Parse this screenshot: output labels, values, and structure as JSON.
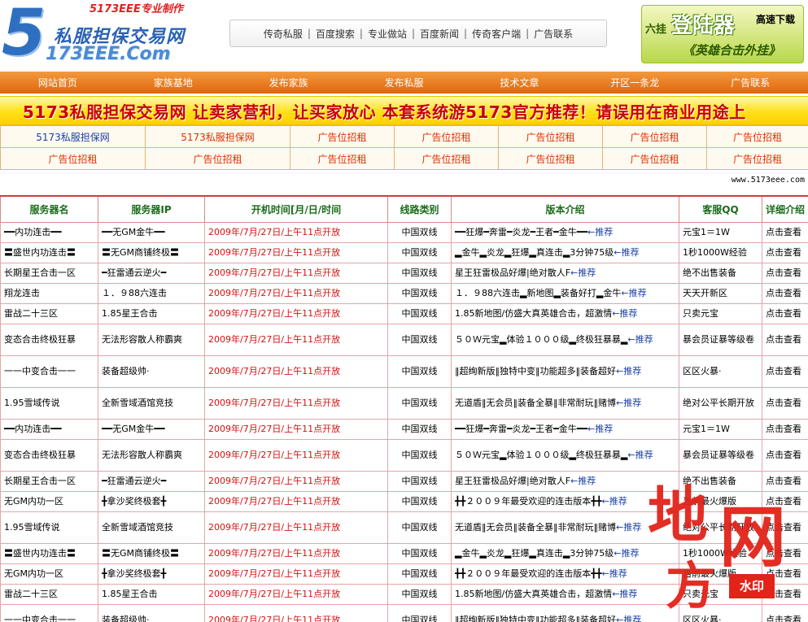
{
  "logo": {
    "tagline": "5173EEE专业制作",
    "name_cn": "私服担保交易网",
    "name_en": "173EEE.Com",
    "digit": "5"
  },
  "top_nav": [
    "传奇私服",
    "百度搜索",
    "专业做站",
    "百度新闻",
    "传奇客户端",
    "广告联系"
  ],
  "right_ad": {
    "small": "六挂",
    "big": "登陆器",
    "download": "高速下载",
    "sub": "《英雄合击外挂》"
  },
  "main_nav": [
    "网站首页",
    "家族基地",
    "发布家族",
    "发布私服",
    "技术文章",
    "开区一条龙",
    "广告联系"
  ],
  "banner": "5173私服担保交易网 让卖家营利，让买家放心 本套系统游5173官方推荐！请误用在商业用途上",
  "ad_grid": [
    [
      "5173私服担保网",
      "5173私服担保网",
      "广告位招租",
      "广告位招租",
      "广告位招租",
      "广告位招租",
      "广告位招租"
    ],
    [
      "广告位招租",
      "广告位招租",
      "广告位招租",
      "广告位招租",
      "广告位招租",
      "广告位招租",
      "广告位招租"
    ]
  ],
  "site_url": "www.5173eee.com",
  "table": {
    "headers": [
      "服务器名",
      "服务器IP",
      "开机时间[月/日/时间",
      "线路类别",
      "版本介绍",
      "客服QQ",
      "详细介绍"
    ],
    "rows": [
      {
        "name": "━━内功连击━━",
        "ip": "━━无GM金牛━━",
        "time": "2009年/7月/27日/上午11点开放",
        "line": "中国双线",
        "intro": "━━狂爆━奔雷━炎龙━王者━金牛━━",
        "rec": "←推荐",
        "qq": "元宝1＝1W",
        "detail": "点击查看",
        "tall": false
      },
      {
        "name": "〓盛世内功连击〓",
        "ip": "〓无GM商铺终极〓",
        "time": "2009年/7月/27日/上午11点开放",
        "line": "中国双线",
        "intro": "▂金牛▂炎龙▂狂爆▂真连击▂3分钟75级",
        "rec": "←推荐",
        "qq": "1秒1000W经验",
        "detail": "点击查看",
        "tall": false
      },
      {
        "name": "长期星王合击一区",
        "ip": "━狂雷通云逆火━",
        "time": "2009年/7月/27日/上午11点开放",
        "line": "中国双线",
        "intro": "星王狂雷极品好爆|绝对散人F",
        "rec": "←推荐",
        "qq": "绝不出售装备",
        "detail": "点击查看",
        "tall": false
      },
      {
        "name": "翔龙连击",
        "ip": "１．９88六连击",
        "time": "2009年/7月/27日/上午11点开放",
        "line": "中国双线",
        "intro": "１．９88六连击▂新地图▂装备好打▂金牛",
        "rec": "←推荐",
        "qq": "天天开新区",
        "detail": "点击查看",
        "tall": false
      },
      {
        "name": "雷战二十三区",
        "ip": "1.85星王合击",
        "time": "2009年/7月/27日/上午11点开放",
        "line": "中国双线",
        "intro": "1.85新地图/仿盛大真英雄合击，超激情",
        "rec": "←推荐",
        "qq": "只卖元宝",
        "detail": "点击查看",
        "tall": false
      },
      {
        "name": "变态合击终极狂暴",
        "ip": "无法形容散人称霸爽",
        "time": "2009年/7月/27日/上午11点开放",
        "line": "中国双线",
        "intro": "５０Ｗ元宝▂体验１０００级▂终极狂暴暴▂",
        "rec": "←推荐",
        "qq": "暴会员证暴等级卷",
        "detail": "点击查看",
        "tall": true
      },
      {
        "name": "一一中变合击一一",
        "ip": "装备超级帅·",
        "time": "2009年/7月/27日/上午11点开放",
        "line": "中国双线",
        "intro": "‖超绚新版‖独特中变‖功能超多‖装备超好",
        "rec": "←推荐",
        "qq": "区区火暴·",
        "detail": "点击查看",
        "tall": true
      },
      {
        "name": "1.95雪域传说",
        "ip": "全新雪域酒馆竞技",
        "time": "2009年/7月/27日/上午11点开放",
        "line": "中国双线",
        "intro": "无道盾‖无会员‖装备全暴‖非常耐玩‖赌博",
        "rec": "←推荐",
        "qq": "绝对公平长期开放",
        "detail": "点击查看",
        "tall": true
      },
      {
        "name": "━━内功连击━━",
        "ip": "━━无GM金牛━━",
        "time": "2009年/7月/27日/上午11点开放",
        "line": "中国双线",
        "intro": "━━狂爆━奔雷━炎龙━王者━金牛━━",
        "rec": "←推荐",
        "qq": "元宝1＝1W",
        "detail": "点击查看",
        "tall": false
      },
      {
        "name": "变态合击终极狂暴",
        "ip": "无法形容散人称霸爽",
        "time": "2009年/7月/27日/上午11点开放",
        "line": "中国双线",
        "intro": "５０Ｗ元宝▂体验１０００级▂终极狂暴暴▂",
        "rec": "←推荐",
        "qq": "暴会员证暴等级卷",
        "detail": "点击查看",
        "tall": true
      },
      {
        "name": "长期星王合击一区",
        "ip": "━狂雷通云逆火━",
        "time": "2009年/7月/27日/上午11点开放",
        "line": "中国双线",
        "intro": "星王狂雷极品好爆|绝对散人F",
        "rec": "←推荐",
        "qq": "绝不出售装备",
        "detail": "点击查看",
        "tall": false
      },
      {
        "name": "无GM内功一区",
        "ip": "╋拿沙奖终极套╋",
        "time": "2009年/7月/27日/上午11点开放",
        "line": "中国双线",
        "intro": "╋╋２００９年最受欢迎的连击版本╋╋",
        "rec": "←推荐",
        "qq": "当前最火爆版",
        "detail": "点击查看",
        "tall": false
      },
      {
        "name": "1.95雪域传说",
        "ip": "全新雪域酒馆竞技",
        "time": "2009年/7月/27日/上午11点开放",
        "line": "中国双线",
        "intro": "无道盾‖无会员‖装备全暴‖非常耐玩‖赌博",
        "rec": "←推荐",
        "qq": "绝对公平长期开放",
        "detail": "点击查看",
        "tall": true
      },
      {
        "name": "〓盛世内功连击〓",
        "ip": "〓无GM商铺终极〓",
        "time": "2009年/7月/27日/上午11点开放",
        "line": "中国双线",
        "intro": "▂金牛▂炎龙▂狂爆▂真连击▂3分钟75级",
        "rec": "←推荐",
        "qq": "1秒1000W经验",
        "detail": "点击查看",
        "tall": false
      },
      {
        "name": "无GM内功一区",
        "ip": "╋拿沙奖终极套╋",
        "time": "2009年/7月/27日/上午11点开放",
        "line": "中国双线",
        "intro": "╋╋２００９年最受欢迎的连击版本╋╋",
        "rec": "←推荐",
        "qq": "当前最火爆版",
        "detail": "点击查看",
        "tall": false
      },
      {
        "name": "雷战二十三区",
        "ip": "1.85星王合击",
        "time": "2009年/7月/27日/上午11点开放",
        "line": "中国双线",
        "intro": "1.85新地图/仿盛大真英雄合击，超激情",
        "rec": "←推荐",
        "qq": "只卖元宝",
        "detail": "点击查看",
        "tall": false
      },
      {
        "name": "一一中变合击一一",
        "ip": "装备超级帅·",
        "time": "2009年/7月/27日/上午11点开放",
        "line": "中国双线",
        "intro": "‖超绚新版‖独特中变‖功能超多‖装备超好",
        "rec": "←推荐",
        "qq": "区区火暴·",
        "detail": "点击查看",
        "tall": true
      }
    ]
  },
  "watermark": {
    "c1": "地",
    "c2": "网",
    "c3": "方",
    "stamp": "水印"
  }
}
